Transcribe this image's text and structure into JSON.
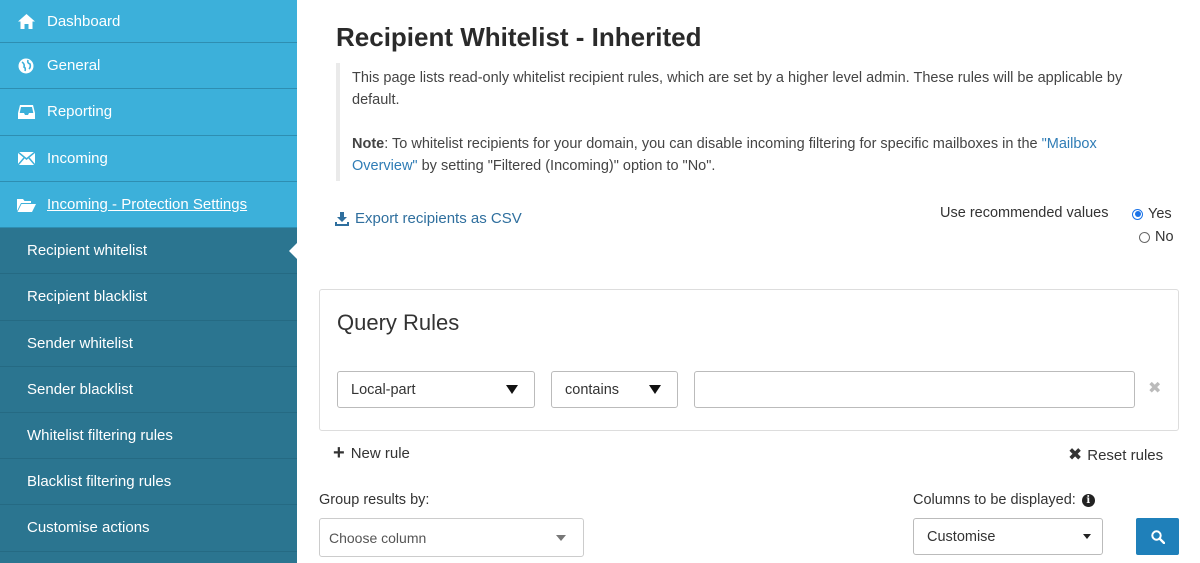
{
  "sidebar": {
    "top_items": [
      {
        "label": "Dashboard",
        "icon": "home-icon"
      },
      {
        "label": "General",
        "icon": "globe-icon"
      },
      {
        "label": "Reporting",
        "icon": "inbox-icon"
      },
      {
        "label": "Incoming",
        "icon": "envelope-icon"
      },
      {
        "label": "Incoming - Protection Settings",
        "icon": "folder-open-icon"
      }
    ],
    "sub_items": [
      {
        "label": "Recipient whitelist"
      },
      {
        "label": "Recipient blacklist"
      },
      {
        "label": "Sender whitelist"
      },
      {
        "label": "Sender blacklist"
      },
      {
        "label": "Whitelist filtering rules"
      },
      {
        "label": "Blacklist filtering rules"
      },
      {
        "label": "Customise actions"
      }
    ],
    "active_sub": "Recipient whitelist"
  },
  "main": {
    "title": "Recipient Whitelist - Inherited",
    "info_line1": "This page lists read-only whitelist recipient rules, which are set by a higher level admin. These rules will be applicable by default.",
    "note_label": "Note",
    "note_text_a": ": To whitelist recipients for your domain, you can disable incoming filtering for specific mailboxes in the ",
    "note_link": "\"Mailbox Overview\"",
    "note_text_b": " by setting \"Filtered (Incoming)\" option to \"No\".",
    "export_label": "Export recipients as CSV",
    "recommended_label": "Use recommended values",
    "radio_yes": "Yes",
    "radio_no": "No",
    "radio_selected": "Yes"
  },
  "query_rules": {
    "title": "Query Rules",
    "field_select": "Local-part",
    "operator_select": "contains",
    "value_input": "",
    "new_rule_label": "New rule",
    "reset_rules_label": "Reset rules"
  },
  "filters": {
    "group_label": "Group results by:",
    "group_placeholder": "Choose column",
    "columns_label": "Columns to be displayed:",
    "columns_select": "Customise"
  },
  "colors": {
    "sidebar_top": "#3cb0da",
    "sidebar_sub": "#2b7590",
    "link": "#2f7cb5",
    "search_button": "#1f80ba"
  }
}
